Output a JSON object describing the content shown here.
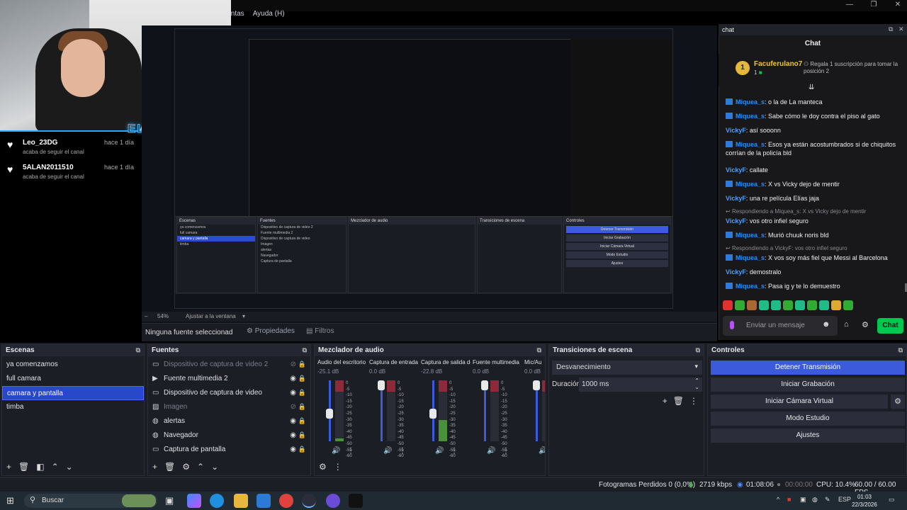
{
  "menu": {
    "items": [
      "ientas",
      "Ayuda (H)"
    ]
  },
  "webcam": {
    "overlay_text": "ELIASDAPP"
  },
  "alerts": [
    {
      "name": "Leo_23DG",
      "time": "hace 1 día",
      "text": "acaba de seguir el canal"
    },
    {
      "name": "5ALAN2011510",
      "time": "hace 1 día",
      "text": "acaba de seguir el canal"
    }
  ],
  "preview": {
    "zoom": "54%",
    "fit_label": "Ajustar a la ventana"
  },
  "source_bar": {
    "no_source": "Ninguna fuente seleccionad",
    "properties": "Propiedades",
    "filters": "Filtros"
  },
  "chat": {
    "dock_label": "chat",
    "title": "Chat",
    "pinned": {
      "user": "Facuferulano7",
      "count": "1",
      "badge": "1",
      "gift_text": "Regala 1 suscripción para tomar la posición 2"
    },
    "messages": [
      {
        "user": "Miquea_s",
        "text": "o la de La manteca",
        "kind": "m"
      },
      {
        "user": "Miquea_s",
        "text": "Sabe cómo le doy contra el piso al gato",
        "kind": "m"
      },
      {
        "user": "VickyF",
        "text": "así sooonn",
        "kind": "v"
      },
      {
        "user": "Miquea_s",
        "text": "Esos ya están acostumbrados si de chiquitos corrían de la policía bld",
        "kind": "m"
      },
      {
        "user": "VickyF",
        "text": "callate",
        "kind": "v"
      },
      {
        "user": "Miquea_s",
        "text": "X vs Vicky dejo de mentir",
        "kind": "m"
      },
      {
        "user": "VickyF",
        "text": "una re película Elías jaja",
        "kind": "v"
      },
      {
        "reply": "Respondiendo a Miquea_s: X vs Vicky dejo de mentir"
      },
      {
        "user": "VickyF",
        "text": "vos otro infiel seguro",
        "kind": "v"
      },
      {
        "user": "Miquea_s",
        "text": "Murió chuuk noris bld",
        "kind": "m"
      },
      {
        "reply": "Respondiendo a VickyF: vos otro infiel seguro"
      },
      {
        "user": "Miquea_s",
        "text": "X vos soy más fiel que Messi al Barcelona",
        "kind": "m"
      },
      {
        "user": "VickyF",
        "text": "demostralo",
        "kind": "v"
      },
      {
        "user": "Miquea_s",
        "text": "Pasa ig y te lo demuestro",
        "kind": "m"
      }
    ],
    "input_placeholder": "Enviar un mensaje",
    "send_label": "Chat"
  },
  "scenes": {
    "title": "Escenas",
    "items": [
      "ya comenzamos",
      "full camara",
      "camara y pantalla",
      "timba"
    ],
    "selected": "camara y pantalla"
  },
  "sources": {
    "title": "Fuentes",
    "items": [
      {
        "label": "Dispositivo de captura de video 2",
        "visible": false,
        "icon": "camera-icon"
      },
      {
        "label": "Fuente multimedia 2",
        "visible": true,
        "icon": "play-icon"
      },
      {
        "label": "Dispositivo de captura de video",
        "visible": true,
        "icon": "camera-icon"
      },
      {
        "label": "Imagen",
        "visible": false,
        "icon": "image-icon"
      },
      {
        "label": "alertas",
        "visible": true,
        "icon": "globe-icon"
      },
      {
        "label": "Navegador",
        "visible": true,
        "icon": "globe-icon"
      },
      {
        "label": "Captura de pantalla",
        "visible": true,
        "icon": "monitor-icon"
      }
    ]
  },
  "mixer": {
    "title": "Mezclador de audio",
    "channels": [
      {
        "name": "Audio del escritorio",
        "db": "-25.1 dB",
        "fader": 0.45,
        "level": 0.05
      },
      {
        "name": "Captura de entrada",
        "db": "0.0 dB",
        "fader": 1.0,
        "level": 0.0
      },
      {
        "name": "Captura de salida de",
        "db": "-22.8 dB",
        "fader": 0.45,
        "level": 0.35
      },
      {
        "name": "Fuente multimedia",
        "db": "0.0 dB",
        "fader": 1.0,
        "level": 0.0
      },
      {
        "name": "Mic/Au",
        "db": "0.0 dB",
        "fader": 1.0,
        "level": 0.0
      }
    ],
    "scale": [
      "0",
      "-5",
      "-10",
      "-15",
      "-20",
      "-25",
      "-30",
      "-35",
      "-40",
      "-45",
      "-50",
      "-55",
      "-60"
    ]
  },
  "transitions": {
    "title": "Transiciones de escena",
    "selected": "Desvanecimiento",
    "duration_label": "Duración",
    "duration_value": "1000 ms"
  },
  "controls": {
    "title": "Controles",
    "buttons": [
      "Detener Transmisión",
      "Iniciar Grabación",
      "Iniciar Cámara Virtual",
      "Modo Estudio",
      "Ajustes"
    ]
  },
  "status": {
    "dropped": "Fotogramas Perdidos 0 (0,0%)",
    "bitrate": "2719 kbps",
    "stream_time": "01:08:06",
    "rec_time": "00:00:00",
    "cpu": "CPU: 10.4%",
    "fps": "60.00 / 60.00 FPS"
  },
  "taskbar": {
    "search": "Buscar",
    "lang": "ESP",
    "time": "01:03",
    "date": "22/3/2026"
  },
  "colors": {
    "accent": "#3b5bdc",
    "chat_send": "#00c750",
    "bg": "#1c1e26"
  }
}
